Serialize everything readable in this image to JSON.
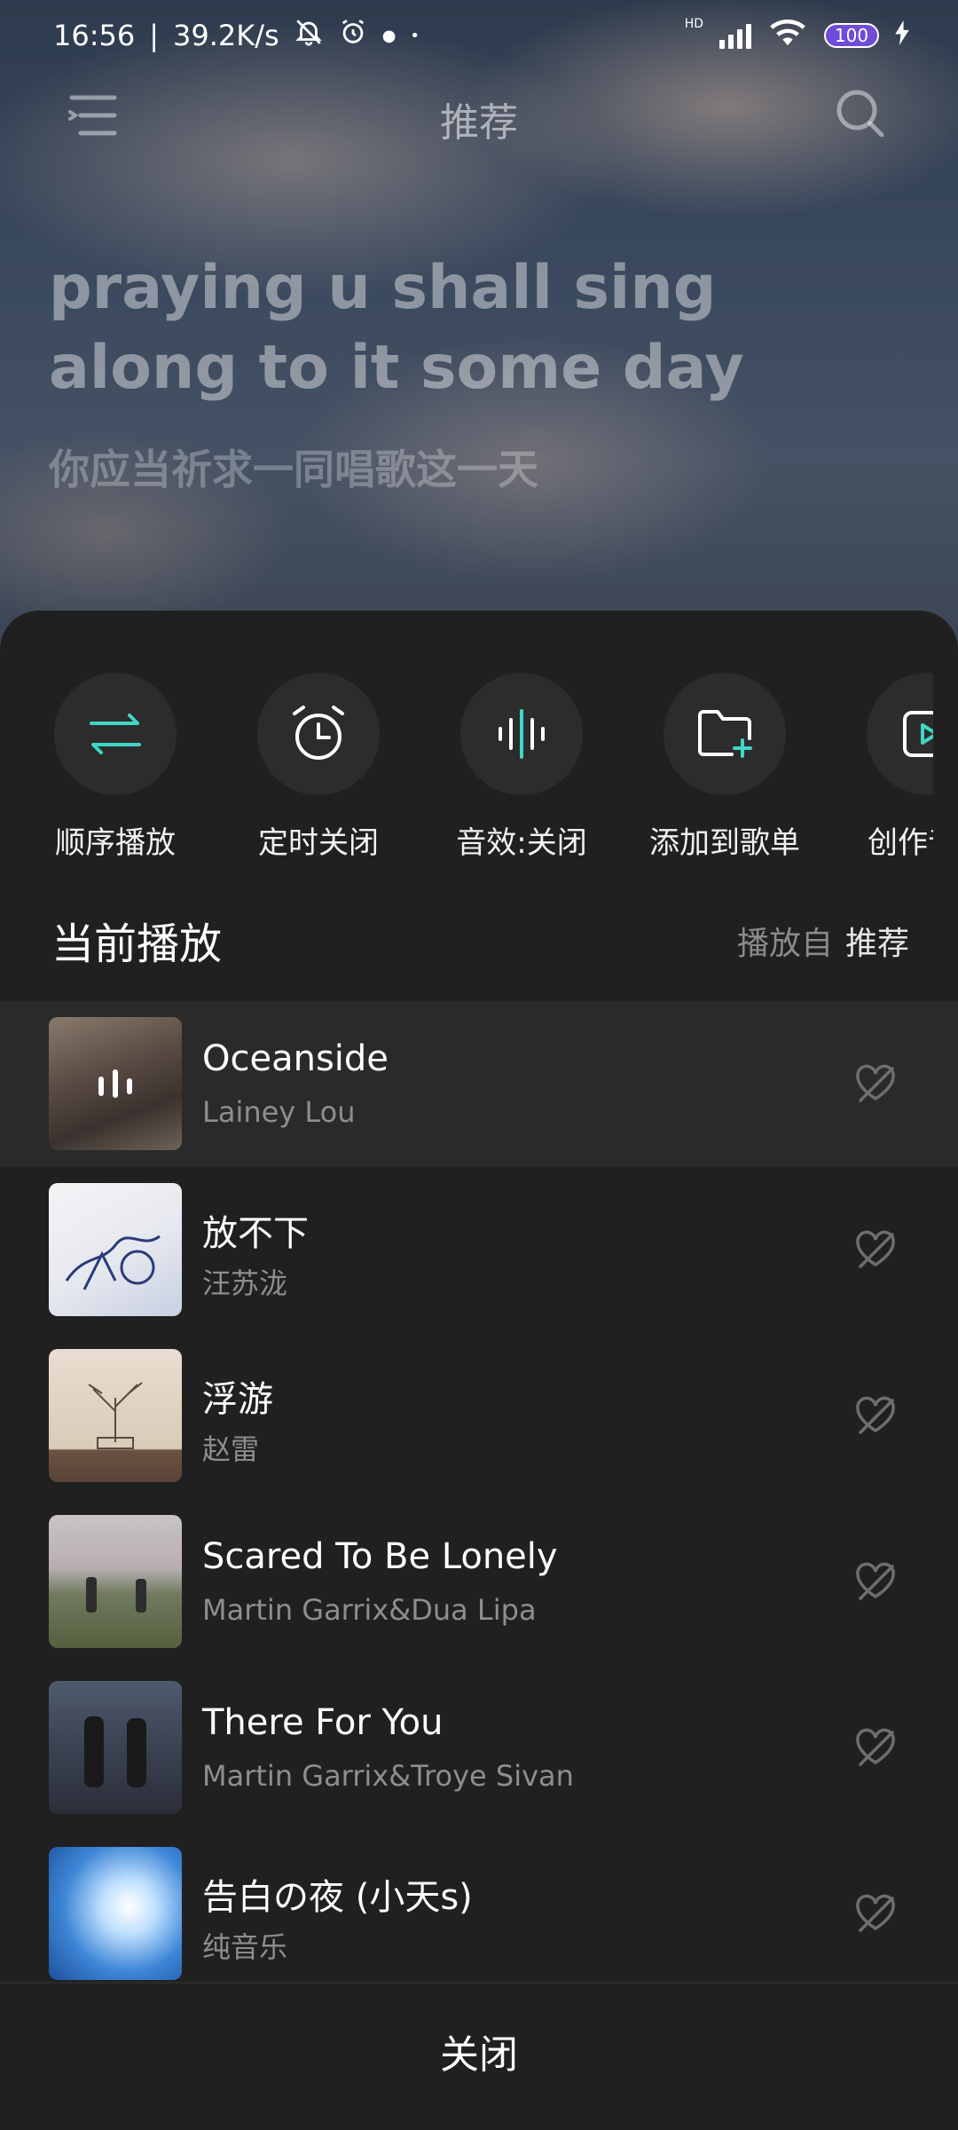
{
  "status_bar": {
    "time": "16:56",
    "net_speed": "39.2K/s",
    "battery": "100",
    "network_badge": "HD"
  },
  "topbar": {
    "title": "推荐",
    "menu_icon": "menu-icon",
    "search_icon": "search-icon"
  },
  "lyrics": {
    "english": "praying u shall sing along to it some day",
    "chinese": "你应当祈求一同唱歌这一天"
  },
  "actions": [
    {
      "label": "顺序播放",
      "icon": "sequential-play-icon"
    },
    {
      "label": "定时关闭",
      "icon": "alarm-clock-icon"
    },
    {
      "label": "音效:关闭",
      "icon": "sound-effect-icon"
    },
    {
      "label": "添加到歌单",
      "icon": "add-to-playlist-icon"
    },
    {
      "label": "创作音乐",
      "icon": "create-music-icon"
    }
  ],
  "section": {
    "title": "当前播放",
    "source_prefix": "播放自",
    "source_name": "推荐"
  },
  "songs": [
    {
      "title": "Oceanside",
      "artist": "Lainey Lou",
      "current": true
    },
    {
      "title": "放不下",
      "artist": "汪苏泷",
      "current": false
    },
    {
      "title": "浮游",
      "artist": "赵雷",
      "current": false
    },
    {
      "title": "Scared To Be Lonely",
      "artist": "Martin Garrix&Dua Lipa",
      "current": false
    },
    {
      "title": "There For You",
      "artist": "Martin Garrix&Troye Sivan",
      "current": false
    },
    {
      "title": "告白の夜 (小天s)",
      "artist": "纯音乐",
      "current": false
    }
  ],
  "close_label": "关闭",
  "colors": {
    "accent": "#3fd6c6",
    "sheet_bg": "#202020",
    "current_row_bg": "#2a2a2a"
  }
}
